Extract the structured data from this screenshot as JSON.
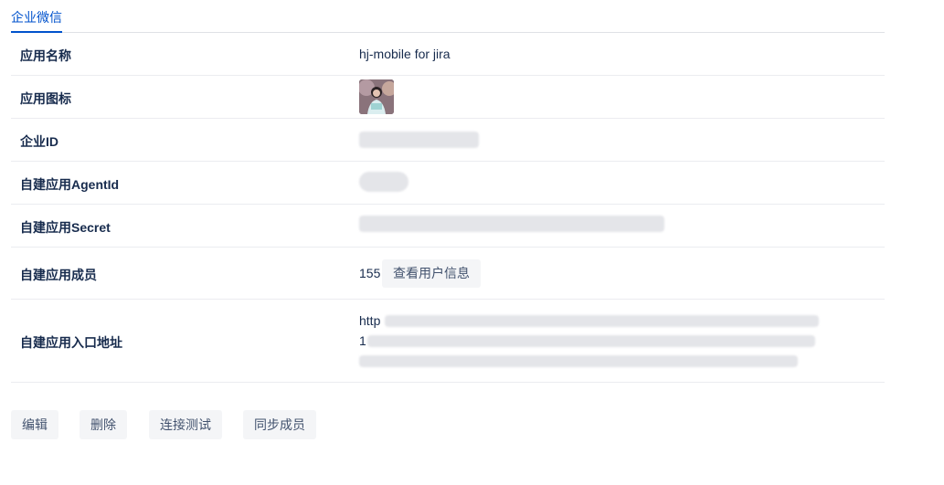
{
  "tabs": {
    "active": "企业微信"
  },
  "fields": {
    "app_name_label": "应用名称",
    "app_name_value": "hj-mobile for jira",
    "app_icon_label": "应用图标",
    "corp_id_label": "企业ID",
    "agent_id_label": "自建应用AgentId",
    "secret_label": "自建应用Secret",
    "members_label": "自建应用成员",
    "members_count": "155",
    "view_users_label": "查看用户信息",
    "entry_label": "自建应用入口地址",
    "entry_line1_visible": "http",
    "entry_line2_visible": "1"
  },
  "actions": {
    "edit": "编辑",
    "delete": "删除",
    "test": "连接测试",
    "sync": "同步成员"
  }
}
